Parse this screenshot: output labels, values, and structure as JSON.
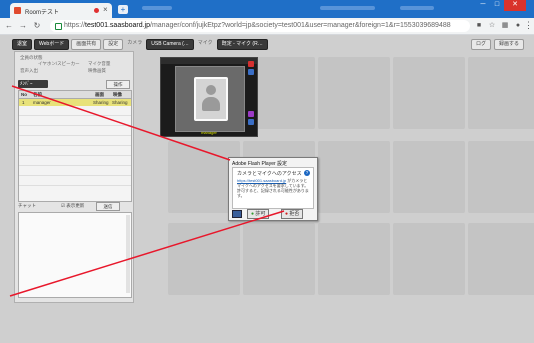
{
  "browser": {
    "tab_title": "Roomテスト",
    "new_tab": "+",
    "window_buttons": [
      "─",
      "□",
      "✕"
    ],
    "url_scheme": "https://",
    "url_host": "test001.saasboard.jp",
    "url_path": "/manager/conf/jujkEtpz?world=jp&society=test001&user=manager&foreign=1&r=15530396894​88"
  },
  "app": {
    "top_buttons": [
      "退室",
      "Webボード",
      "画面共有",
      "設定"
    ],
    "camera_label": "カメラ",
    "camera_select": "USB Camera (…",
    "mic_label": "マイク",
    "mic_select": "既定 - マイク (R…",
    "right_buttons": [
      "ログ",
      "録画する"
    ],
    "opts": [
      "全員の状態",
      "イヤホン/スピーカー",
      "音声入出",
      "マイク音量",
      "映像画質"
    ],
    "member_title": "ﾒﾝﾊﾞｰ",
    "member_button": "操作",
    "member_headers": [
      "No",
      "名前",
      "画面",
      "映像"
    ],
    "members": [
      {
        "no": "1",
        "name": "manager",
        "screen": "Sharing",
        "video": "Sharing"
      }
    ],
    "chat_label": "チャット",
    "chat_check": "☑ 表示更新",
    "chat_button": "送信"
  },
  "video": {
    "name": "manager"
  },
  "flash_dialog": {
    "title": "Adobe Flash Player 設定",
    "heading": "カメラとマイクへのアクセス",
    "link": "https://test001.saasboard.jp",
    "body": "がカメラとマイクへのアクセスを要求しています。許可すると、記録される可能性があります。",
    "allow": "許可",
    "deny": "拒否"
  },
  "colors": {
    "browser_blue": "#1f6fc7",
    "highlight_row": "#e8e27a",
    "annotation_red": "#e8172b"
  }
}
